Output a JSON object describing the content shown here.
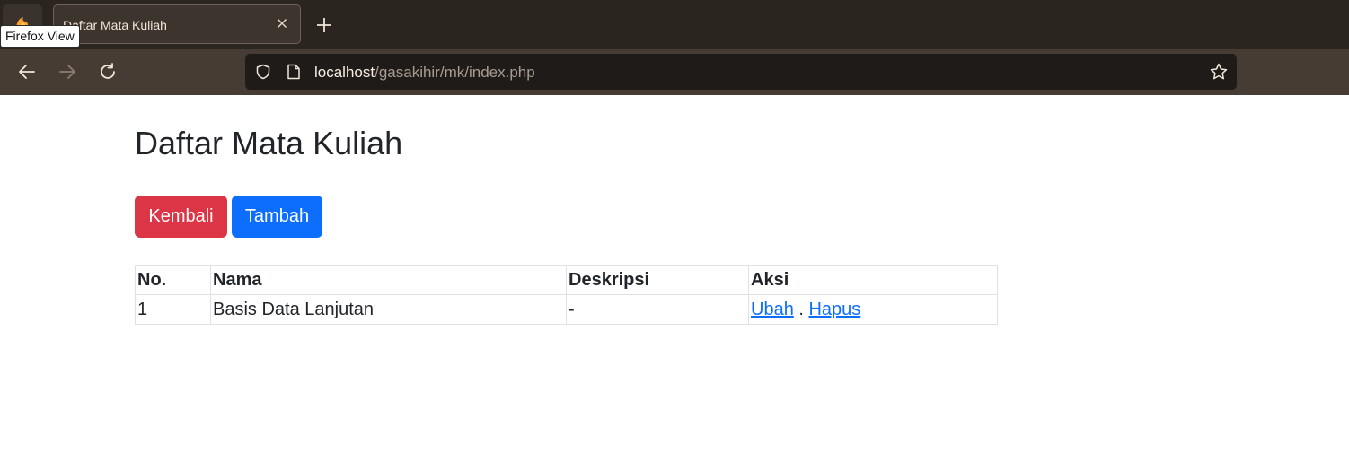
{
  "browser": {
    "tooltip": "Firefox View",
    "tab": {
      "title": "Daftar Mata Kuliah"
    },
    "url": {
      "host": "localhost",
      "path": "/gasakihir/mk/index.php"
    },
    "icons": {
      "firefox_view": "firefox-view-icon",
      "tab_close": "close-icon",
      "new_tab": "plus-icon",
      "back": "arrow-left-icon",
      "forward": "arrow-right-icon",
      "reload": "reload-icon",
      "tracking": "shield-icon",
      "page_info": "page-icon",
      "bookmark": "star-icon"
    }
  },
  "page": {
    "title": "Daftar Mata Kuliah",
    "buttons": {
      "back": "Kembali",
      "add": "Tambah"
    },
    "colors": {
      "back": "#dc3545",
      "add": "#0d6efd",
      "link": "#0d6efd"
    },
    "table": {
      "headers": [
        "No.",
        "Nama",
        "Deskripsi",
        "Aksi"
      ],
      "rows": [
        {
          "no": "1",
          "nama": "Basis Data Lanjutan",
          "deskripsi": "-",
          "edit": "Ubah",
          "separator": " . ",
          "delete": "Hapus"
        }
      ]
    }
  }
}
